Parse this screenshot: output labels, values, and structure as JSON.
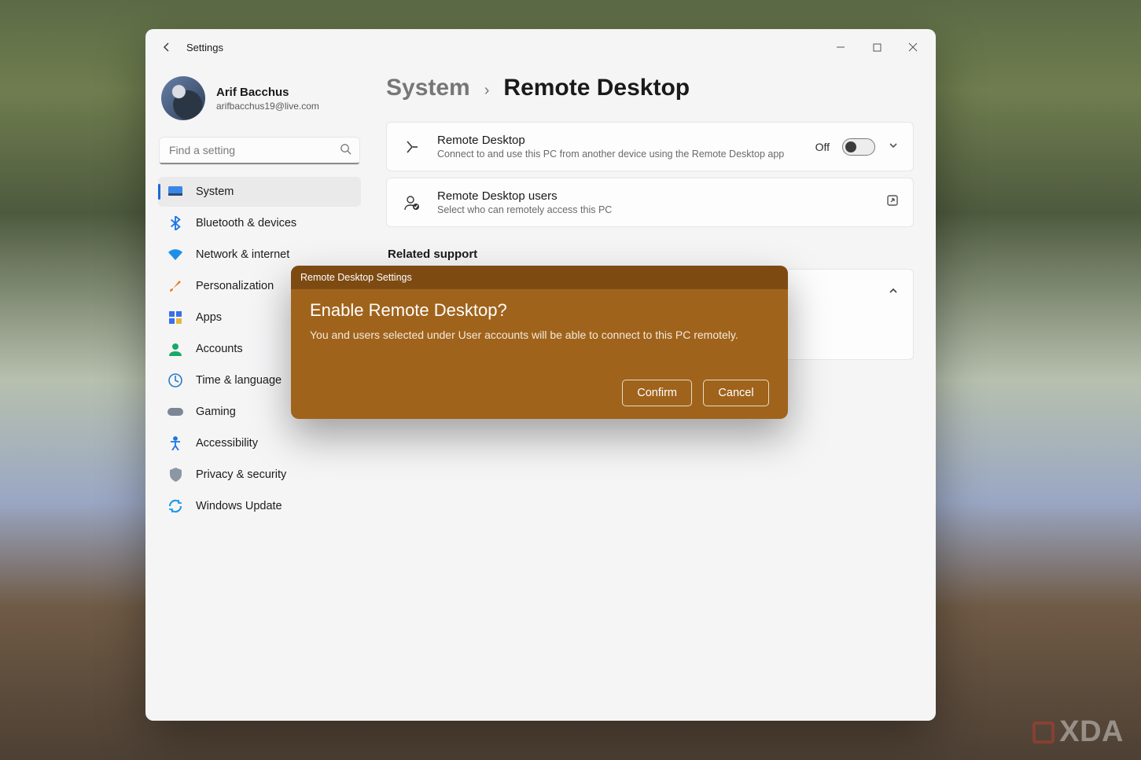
{
  "window": {
    "back_label": "Back",
    "title": "Settings",
    "min_label": "Minimize",
    "max_label": "Maximize",
    "close_label": "Close"
  },
  "profile": {
    "name": "Arif Bacchus",
    "email": "arifbacchus19@live.com"
  },
  "search": {
    "placeholder": "Find a setting"
  },
  "sidebar": {
    "items": [
      {
        "label": "System",
        "active": true
      },
      {
        "label": "Bluetooth & devices"
      },
      {
        "label": "Network & internet"
      },
      {
        "label": "Personalization"
      },
      {
        "label": "Apps"
      },
      {
        "label": "Accounts"
      },
      {
        "label": "Time & language"
      },
      {
        "label": "Gaming"
      },
      {
        "label": "Accessibility"
      },
      {
        "label": "Privacy & security"
      },
      {
        "label": "Windows Update"
      }
    ]
  },
  "breadcrumb": {
    "parent": "System",
    "current": "Remote Desktop"
  },
  "cards": {
    "remote_desktop": {
      "title": "Remote Desktop",
      "sub": "Connect to and use this PC from another device using the Remote Desktop app",
      "state_label": "Off"
    },
    "users": {
      "title": "Remote Desktop users",
      "sub": "Select who can remotely access this PC"
    }
  },
  "related_support_label": "Related support",
  "modal": {
    "titlebar": "Remote Desktop Settings",
    "heading": "Enable Remote Desktop?",
    "text": "You and users selected under User accounts will be able to connect to this PC remotely.",
    "confirm": "Confirm",
    "cancel": "Cancel"
  },
  "watermark": "XDA"
}
